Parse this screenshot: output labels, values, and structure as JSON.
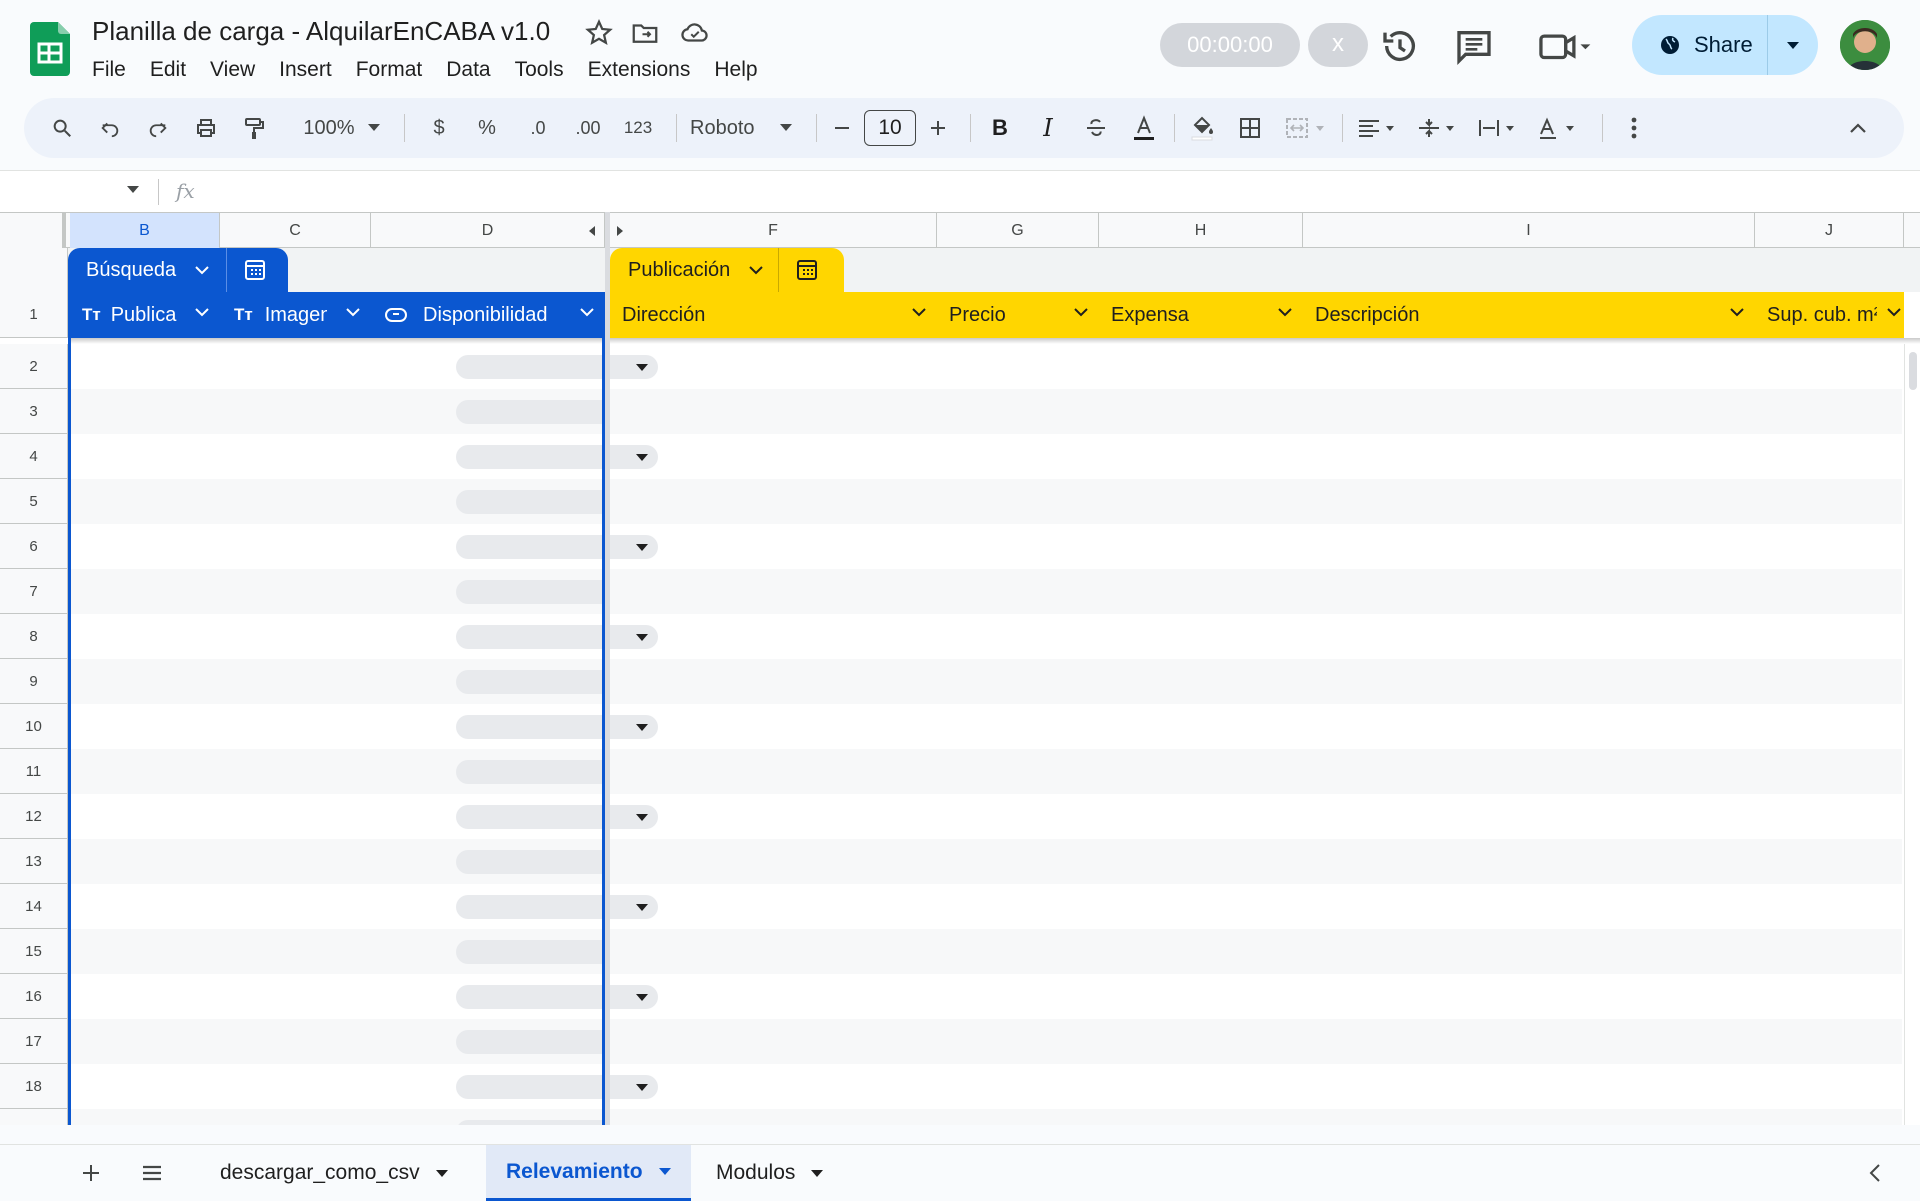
{
  "document": {
    "title": "Planilla de carga - AlquilarEnCABA v1.0",
    "menu": [
      "File",
      "Edit",
      "View",
      "Insert",
      "Format",
      "Data",
      "Tools",
      "Extensions",
      "Help"
    ]
  },
  "topbar": {
    "timer": "00:00:00",
    "close": "x",
    "share_label": "Share"
  },
  "toolbar": {
    "zoom": "100%",
    "currency": "$",
    "percent": "%",
    "dec_decrease": ".0",
    "dec_increase": ".00",
    "number_format": "123",
    "font": "Roboto",
    "font_size": "10",
    "bold": "B",
    "italic": "I"
  },
  "formula_bar": {
    "fx": "fx"
  },
  "columns": [
    "B",
    "C",
    "D",
    "F",
    "G",
    "H",
    "I",
    "J"
  ],
  "table_busqueda": {
    "name": "Búsqueda",
    "color": "#0b57d0",
    "headers": [
      "Publica",
      "Imagen",
      "Disponibilidad"
    ]
  },
  "table_publicacion": {
    "name": "Publicación",
    "color": "#ffd600",
    "headers": [
      "Dirección",
      "Precio",
      "Expensa",
      "Descripción",
      "Sup. cub. m²"
    ]
  },
  "row_numbers": [
    "1",
    "2",
    "3",
    "4",
    "5",
    "6",
    "7",
    "8",
    "9",
    "10",
    "11",
    "12",
    "13",
    "14",
    "15",
    "16",
    "17",
    "18"
  ],
  "sheets": {
    "tabs": [
      "descargar_como_csv",
      "Relevamiento",
      "Modulos"
    ],
    "active": "Relevamiento"
  },
  "icons": [
    "sheets-logo-icon",
    "star-icon",
    "move-folder-icon",
    "cloud-saved-icon",
    "history-icon",
    "comments-icon",
    "meet-icon",
    "globe-icon",
    "search-icon",
    "undo-icon",
    "redo-icon",
    "print-icon",
    "paint-format-icon",
    "strikethrough-icon",
    "text-color-icon",
    "fill-color-icon",
    "borders-icon",
    "merge-icon",
    "align-icon",
    "valign-icon",
    "wrap-icon",
    "rotate-icon",
    "more-icon",
    "collapse-icon",
    "text-type-icon",
    "dropdown-type-icon",
    "table-calc-icon",
    "add-sheet-icon",
    "all-sheets-icon"
  ]
}
